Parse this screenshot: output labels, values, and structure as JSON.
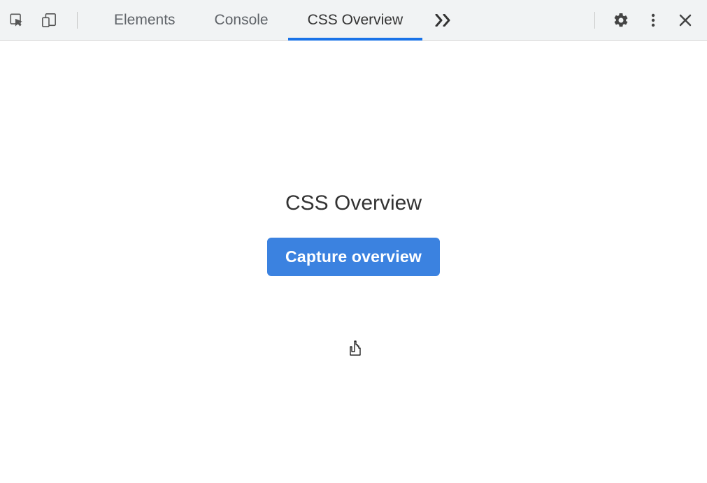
{
  "toolbar": {
    "tabs": [
      {
        "label": "Elements",
        "active": false
      },
      {
        "label": "Console",
        "active": false
      },
      {
        "label": "CSS Overview",
        "active": true
      }
    ]
  },
  "panel": {
    "title": "CSS Overview",
    "capture_label": "Capture overview"
  }
}
